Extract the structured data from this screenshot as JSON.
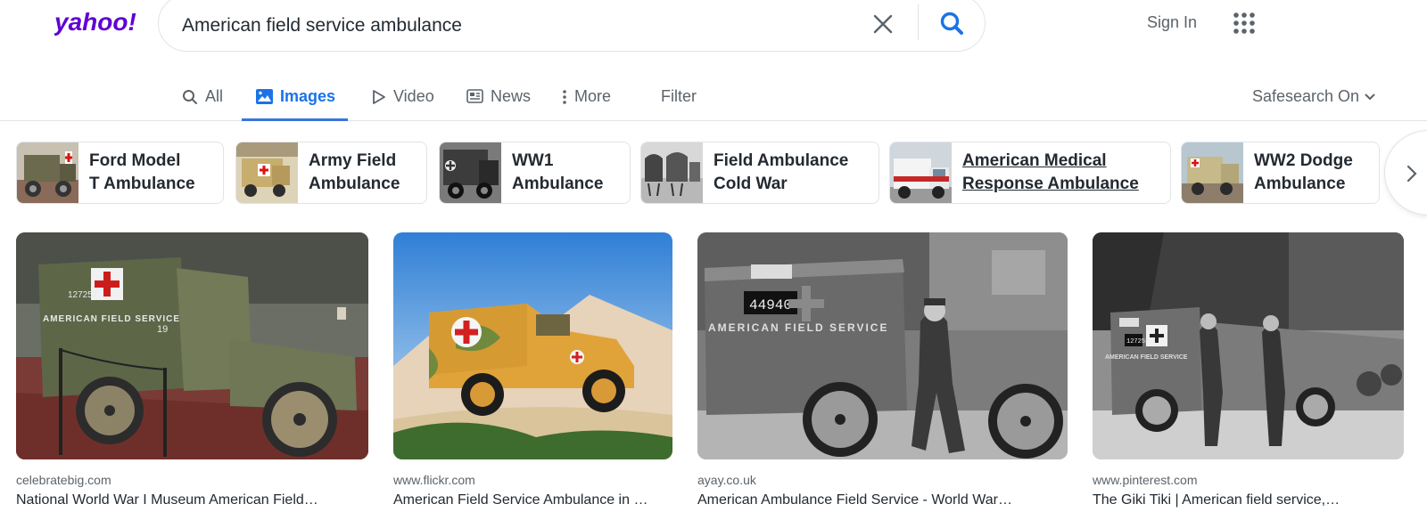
{
  "header": {
    "logo_text": "yahoo!",
    "search": {
      "value": "American field service ambulance",
      "placeholder": ""
    },
    "sign_in_label": "Sign In"
  },
  "tabs": [
    {
      "label": "All",
      "icon": "search-icon"
    },
    {
      "label": "Images",
      "icon": "image-icon",
      "active": true
    },
    {
      "label": "Video",
      "icon": "play-icon"
    },
    {
      "label": "News",
      "icon": "news-icon"
    },
    {
      "label": "More",
      "icon": "more-vertical-icon"
    }
  ],
  "filter_label": "Filter",
  "safesearch_label": "Safesearch On",
  "related": [
    {
      "line1": "Ford Model",
      "line2": "T Ambulance"
    },
    {
      "line1": "Army Field",
      "line2": "Ambulance"
    },
    {
      "line1": "WW1",
      "line2": "Ambulance"
    },
    {
      "line1": "Field Ambulance",
      "line2": "Cold War"
    },
    {
      "line1": "American Medical",
      "line2": "Response Ambulance"
    },
    {
      "line1": "WW2 Dodge",
      "line2": "Ambulance"
    }
  ],
  "results": [
    {
      "domain": "celebratebig.com",
      "title": "National World War I Museum American Field…",
      "image_labels": [
        "127257",
        "AMERICAN FIELD SERVICE",
        "19"
      ]
    },
    {
      "domain": "www.flickr.com",
      "title": "American Field Service Ambulance in …",
      "image_labels": []
    },
    {
      "domain": "ayay.co.uk",
      "title": "American Ambulance Field Service - World War…",
      "image_labels": [
        "44940",
        "AMERICAN FIELD SERVICE"
      ]
    },
    {
      "domain": "www.pinterest.com",
      "title": "The Giki Tiki | American field service,…",
      "image_labels": [
        "127253",
        "AMERICAN FIELD SERVICE"
      ]
    }
  ],
  "colors": {
    "brand": "#6001d2",
    "accent": "#1a73e8",
    "text": "#232a31",
    "muted": "#5b636a",
    "border": "#e0e4e9"
  }
}
